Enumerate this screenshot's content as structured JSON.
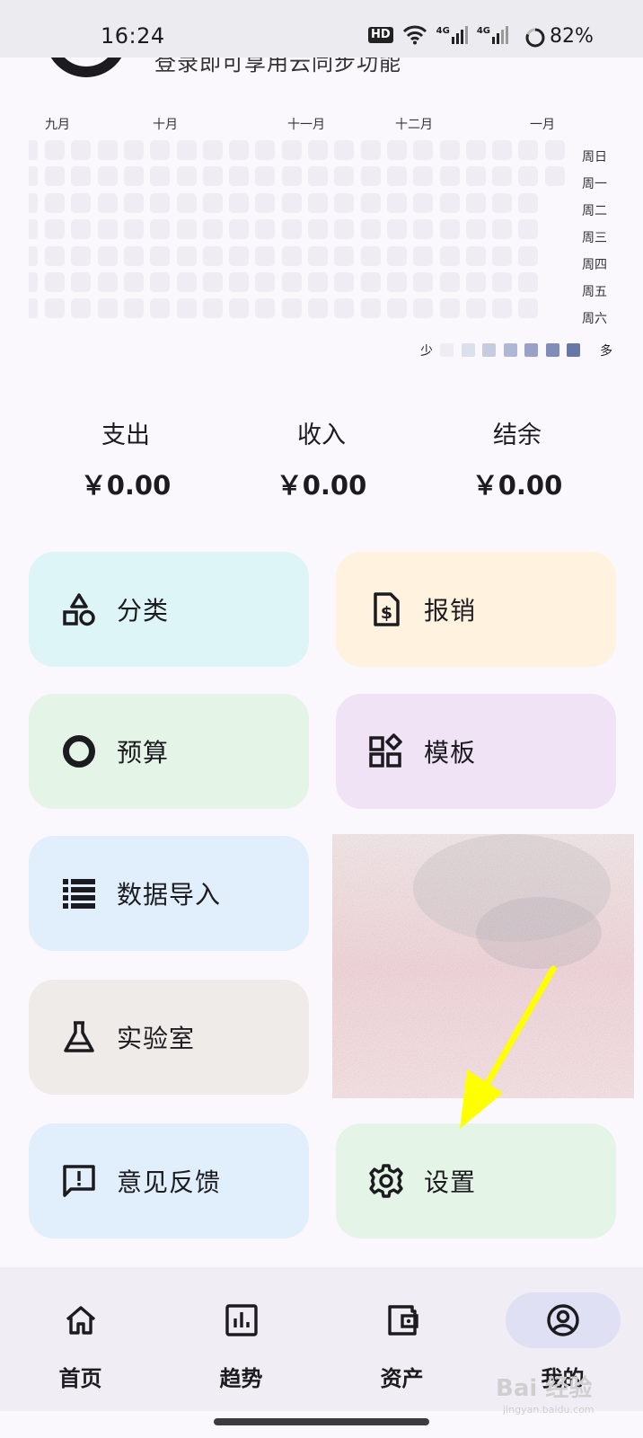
{
  "status_bar": {
    "time": "16:24",
    "hd": "HD",
    "net1": "4G",
    "net2": "4G",
    "battery": "82%"
  },
  "header": {
    "login_hint": "登录即可享用云同步功能"
  },
  "heatmap": {
    "months": [
      "九月",
      "十月",
      "十一月",
      "十二月",
      "一月"
    ],
    "weekdays": [
      "周日",
      "周一",
      "周二",
      "周三",
      "周四",
      "周五",
      "周六"
    ],
    "legend_less": "少",
    "legend_more": "多",
    "legend_colors": [
      "#efedf3",
      "#dcdfec",
      "#c6cce0",
      "#aeb7d4",
      "#97a2c6",
      "#7f8db8",
      "#6877a9"
    ]
  },
  "summary": [
    {
      "label": "支出",
      "value": "￥0.00"
    },
    {
      "label": "收入",
      "value": "￥0.00"
    },
    {
      "label": "结余",
      "value": "￥0.00"
    }
  ],
  "tiles": {
    "category": "分类",
    "reimburse": "报销",
    "budget": "预算",
    "template": "模板",
    "import": "数据导入",
    "lab": "实验室",
    "feedback": "意见反馈",
    "settings": "设置"
  },
  "nav": [
    {
      "label": "首页",
      "icon": "home-icon"
    },
    {
      "label": "趋势",
      "icon": "chart-icon"
    },
    {
      "label": "资产",
      "icon": "wallet-icon"
    },
    {
      "label": "我的",
      "icon": "account-icon"
    }
  ],
  "watermark": {
    "text": "Bai 经验",
    "sub": "jingyan.baidu.com"
  }
}
